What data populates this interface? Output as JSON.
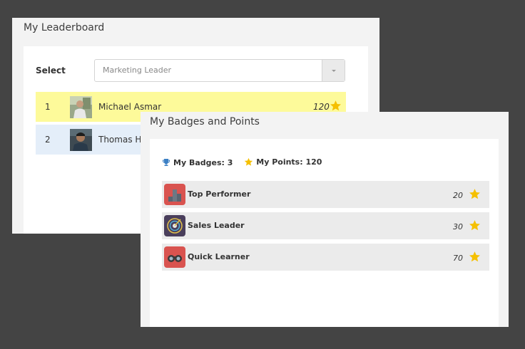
{
  "leaderboard": {
    "title": "My Leaderboard",
    "select_label": "Select",
    "select_value": "Marketing Leader",
    "rows": [
      {
        "rank": "1",
        "name": "Michael Asmar",
        "points": "120"
      },
      {
        "rank": "2",
        "name": "Thomas He",
        "points": ""
      }
    ]
  },
  "badges": {
    "title": "My Badges and Points",
    "summary": {
      "badges_label": "My Badges: 3",
      "points_label": "My Points: 120"
    },
    "items": [
      {
        "name": "Top Performer",
        "points": "20",
        "icon": "top-performer-badge-icon"
      },
      {
        "name": "Sales Leader",
        "points": "30",
        "icon": "sales-leader-badge-icon"
      },
      {
        "name": "Quick Learner",
        "points": "70",
        "icon": "quick-learner-badge-icon"
      }
    ]
  },
  "colors": {
    "background": "#444444",
    "highlight_row": "#fdfa9a",
    "alt_row": "#e4eef9",
    "star": "#f5c000",
    "trophy": "#3b7fc4"
  }
}
